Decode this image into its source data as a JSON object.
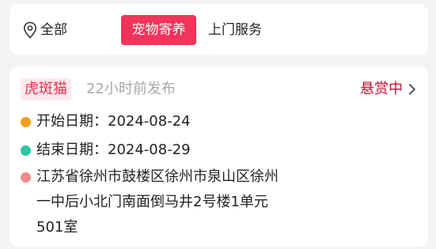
{
  "filter_bar": {
    "location_icon": "location-pin-icon",
    "location_label": "全部",
    "tabs": [
      {
        "label": "宠物寄养",
        "active": true
      },
      {
        "label": "上门服务",
        "active": false
      }
    ],
    "active_color": "#f2335a"
  },
  "task": {
    "tag": "虎斑猫",
    "posted": "22小时前发布",
    "status": "悬赏中",
    "status_color": "#c8102e",
    "start_date": "开始日期：2024-08-24",
    "end_date": "结束日期：2024-08-29",
    "address": "江苏省徐州市鼓楼区徐州市泉山区徐州一中后小北门南面倒马井2号楼1单元501室",
    "dot_colors": {
      "start": "#f4a01c",
      "end": "#2ec4a0",
      "address": "#f28b8b"
    }
  }
}
